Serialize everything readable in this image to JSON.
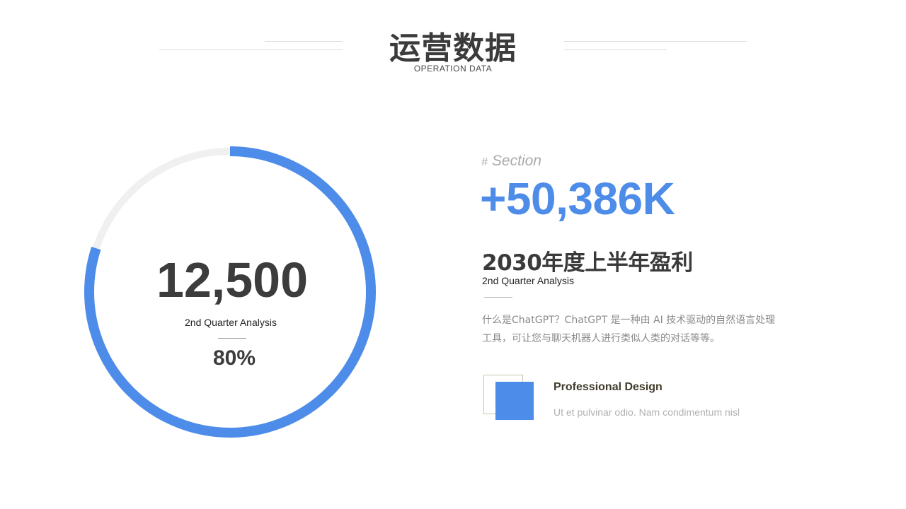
{
  "header": {
    "title": "运营数据",
    "subtitle": "OPERATION DATA"
  },
  "ring": {
    "value": "12,500",
    "label": "2nd Quarter Analysis",
    "percent_text": "80%",
    "progress": 0.8,
    "progress_color": "#4d8ce8",
    "track_color": "#f0f0f0"
  },
  "section": {
    "hash": "#",
    "tag": "Section",
    "stat": "+50,386K",
    "heading": "2030年度上半年盈利",
    "heading_sub": "2nd Quarter Analysis",
    "body_line1": "什么是ChatGPT？ChatGPT 是一种由 AI 技术驱动的自然语言处理",
    "body_line2": "工具，可让您与聊天机器人进行类似人类的对话等等。"
  },
  "feature": {
    "title": "Professional Design",
    "desc": "Ut et pulvinar odio. Nam condimentum nisl",
    "accent_color": "#4d8ce8"
  }
}
